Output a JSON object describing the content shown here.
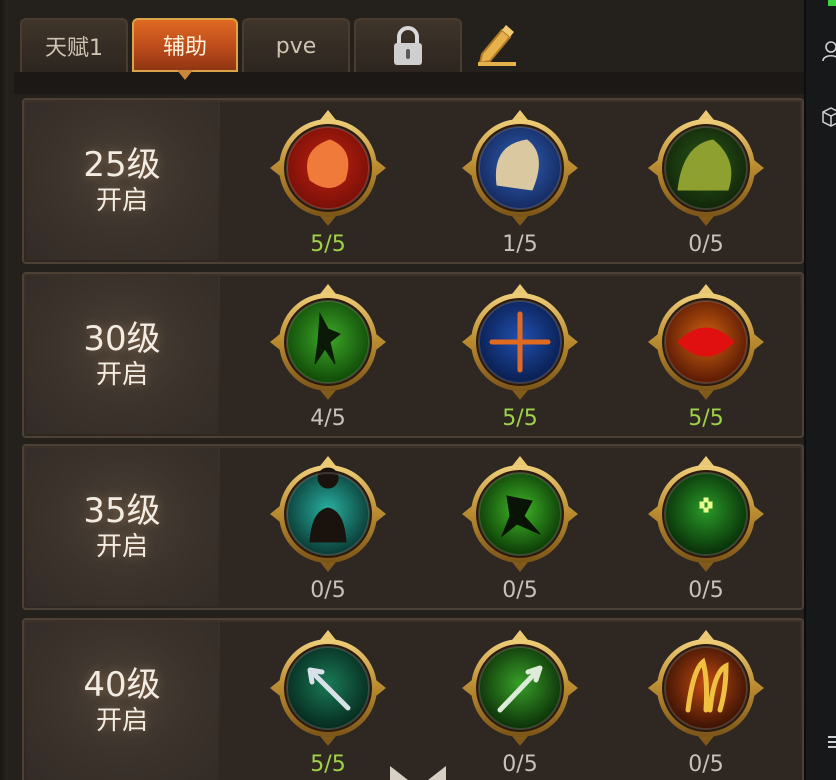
{
  "tabs": [
    {
      "label": "天赋1",
      "active": false
    },
    {
      "label": "辅助",
      "active": true
    },
    {
      "label": "pve",
      "active": false
    },
    {
      "label": "",
      "locked": true
    }
  ],
  "rows": [
    {
      "level": "25级",
      "unlock": "开启",
      "skills": [
        {
          "icon": "claw-skill-icon",
          "count": "5/5",
          "full": true
        },
        {
          "icon": "eagle-skill-icon",
          "count": "1/5",
          "full": false
        },
        {
          "icon": "beast-skill-icon",
          "count": "0/5",
          "full": false
        }
      ]
    },
    {
      "level": "30级",
      "unlock": "开启",
      "skills": [
        {
          "icon": "dash-skill-icon",
          "count": "4/5",
          "full": false
        },
        {
          "icon": "crosshair-skill-icon",
          "count": "5/5",
          "full": true
        },
        {
          "icon": "eye-skill-icon",
          "count": "5/5",
          "full": true
        }
      ]
    },
    {
      "level": "35级",
      "unlock": "开启",
      "skills": [
        {
          "icon": "shadow-skill-icon",
          "count": "0/5",
          "full": false
        },
        {
          "icon": "sprint-skill-icon",
          "count": "0/5",
          "full": false
        },
        {
          "icon": "heal-skill-icon",
          "count": "0/5",
          "full": false
        }
      ]
    },
    {
      "level": "40级",
      "unlock": "开启",
      "skills": [
        {
          "icon": "arrow-skill-icon",
          "count": "5/5",
          "full": true
        },
        {
          "icon": "spear-skill-icon",
          "count": "0/5",
          "full": false
        },
        {
          "icon": "fang-skill-icon",
          "count": "0/5",
          "full": false
        }
      ]
    }
  ],
  "colors": {
    "count_full": "#9fd24a",
    "count_default": "#c8c2ba",
    "tab_active": "#d15c1e",
    "gold_ring": "#c99a3a"
  }
}
